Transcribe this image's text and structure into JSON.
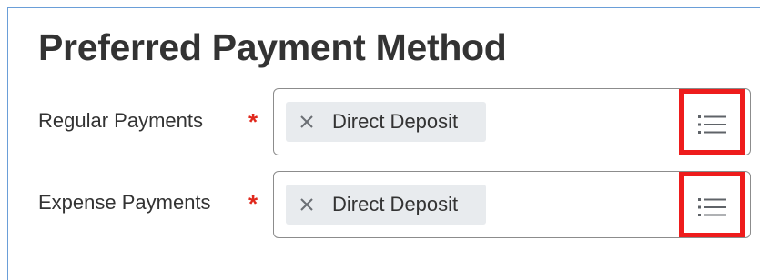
{
  "form": {
    "title": "Preferred Payment Method",
    "required_marker": "*",
    "fields": [
      {
        "label": "Regular Payments",
        "selected_value": "Direct Deposit",
        "remove_icon": "close-icon",
        "list_icon": "list-icon"
      },
      {
        "label": "Expense Payments",
        "selected_value": "Direct Deposit",
        "remove_icon": "close-icon",
        "list_icon": "list-icon"
      }
    ]
  },
  "colors": {
    "required": "#e0281c",
    "highlight": "#ee1c1c",
    "pill_background": "#e8ebee",
    "text": "#333333"
  }
}
